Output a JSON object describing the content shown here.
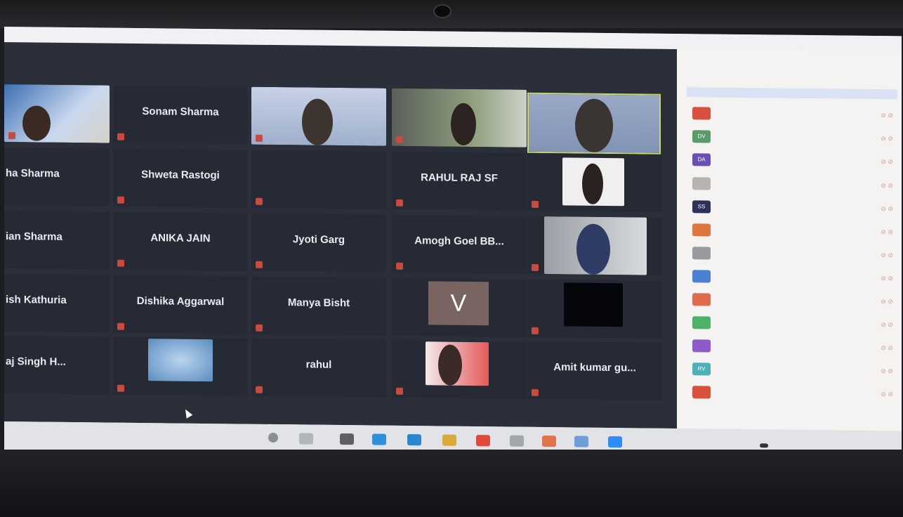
{
  "tiles": {
    "t1": "Sonam Sharma",
    "t2": "ha Sharma",
    "t3": "Shweta Rastogi",
    "t4": "RAHUL RAJ SF",
    "t5": "ian Sharma",
    "t6": "ANIKA JAIN",
    "t7": "Jyoti Garg",
    "t8": "Amogh Goel BB...",
    "t9": "ish Kathuria",
    "t10": "Dishika Aggarwal",
    "t11": "Manya Bisht",
    "t12": "aj Singh H...",
    "t13": "rahul",
    "t14": "Amit kumar gu...",
    "avatar_letter": "V"
  },
  "sidebar": {
    "avatar_texts": [
      "DV",
      "DA",
      "SS",
      "RV"
    ]
  },
  "colors": {
    "zoom_bg": "#2b2f3a",
    "tile_bg": "#252a35",
    "active_border": "#c6d66a"
  }
}
